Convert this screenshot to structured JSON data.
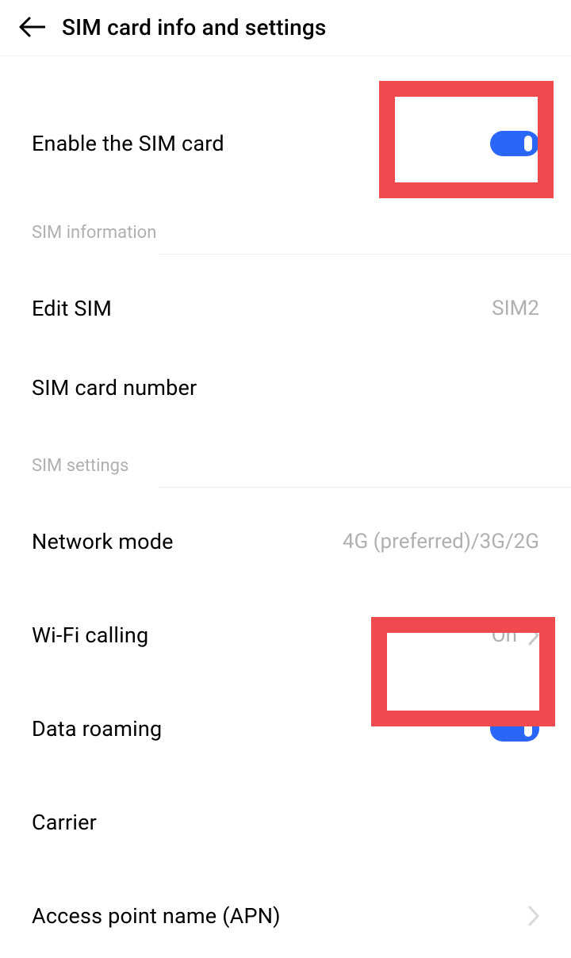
{
  "header": {
    "title": "SIM card info and settings"
  },
  "enable_sim": {
    "label": "Enable the SIM card",
    "on": true
  },
  "section_info": {
    "title": "SIM information"
  },
  "edit_sim": {
    "label": "Edit SIM",
    "value": "SIM2"
  },
  "sim_number": {
    "label": "SIM card number"
  },
  "section_settings": {
    "title": "SIM settings"
  },
  "network_mode": {
    "label": "Network mode",
    "value": "4G (preferred)/3G/2G"
  },
  "wifi_calling": {
    "label": "Wi-Fi calling",
    "value": "On"
  },
  "data_roaming": {
    "label": "Data roaming",
    "on": true
  },
  "carrier": {
    "label": "Carrier"
  },
  "apn": {
    "label": "Access point name (APN)"
  }
}
